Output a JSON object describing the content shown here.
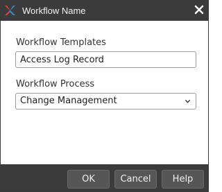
{
  "window": {
    "title": "Workflow Name",
    "app_icon": "brand-x-icon",
    "close_icon": "close-icon"
  },
  "form": {
    "templates_label": "Workflow Templates",
    "templates_value": "Access Log Record",
    "process_label": "Workflow Process",
    "process_value": "Change Management"
  },
  "buttons": {
    "ok": "OK",
    "cancel": "Cancel",
    "help": "Help"
  },
  "colors": {
    "titlebar": "#3b3b3b",
    "footer": "#3b3b3b",
    "button": "#565656",
    "icon_blue": "#2f8fd8",
    "icon_red": "#e0413b"
  }
}
